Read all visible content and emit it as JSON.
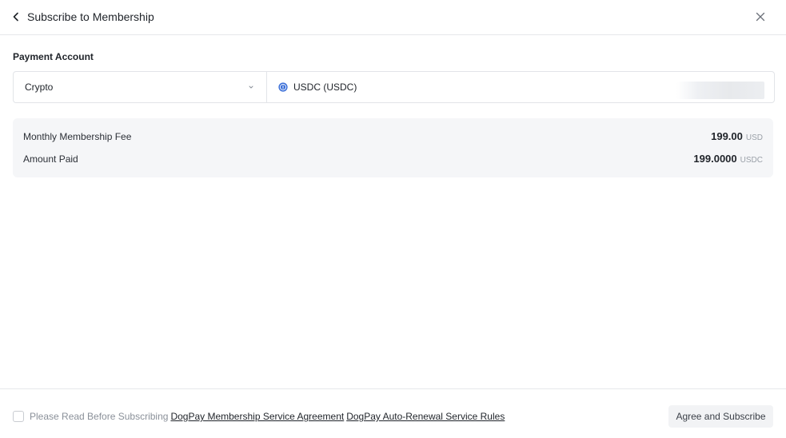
{
  "header": {
    "title": "Subscribe to Membership",
    "back_icon": "chevron-left-icon",
    "close_icon": "close-icon"
  },
  "payment": {
    "label": "Payment Account",
    "account_type": "Crypto",
    "currency": "USDC (USDC)",
    "currency_icon": "usdc-coin-icon",
    "currency_icon_color": "#3b6fd8"
  },
  "summary": {
    "rows": [
      {
        "label": "Monthly Membership Fee",
        "amount": "199.00",
        "unit": "USD"
      },
      {
        "label": "Amount Paid",
        "amount": "199.0000",
        "unit": "USDC"
      }
    ]
  },
  "footer": {
    "agree_prefix": "Please Read Before Subscribing",
    "link_agreement": "DogPay Membership Service Agreement",
    "link_renewal": "DogPay Auto-Renewal Service Rules",
    "button": "Agree and Subscribe"
  }
}
